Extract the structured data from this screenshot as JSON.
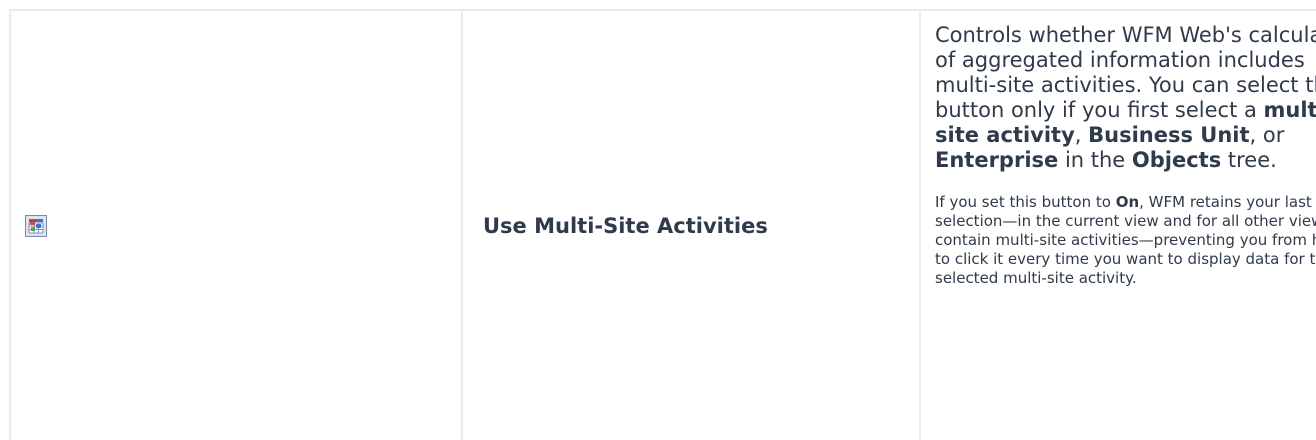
{
  "row": {
    "icon": "multi-site-activities-icon",
    "name": "Use Multi-Site Activities",
    "description": {
      "p1_a": "Controls whether WFM Web's calculation of aggregated information includes multi-site activities. You can select this button only if you first select a ",
      "p1_b1": "multi-site activity",
      "p1_c": ", ",
      "p1_b2": "Business Unit",
      "p1_d": ", or ",
      "p1_b3": "Enterprise",
      "p1_e": " in the ",
      "p1_b4": "Objects",
      "p1_f": " tree.",
      "p2_a": "If you set this button to ",
      "p2_b": "On",
      "p2_c": ",  WFM retains your last selection—in the current view and for all other views that contain multi-site activities—preventing you from having to click it every time you want to display data for the selected multi-site activity."
    }
  }
}
